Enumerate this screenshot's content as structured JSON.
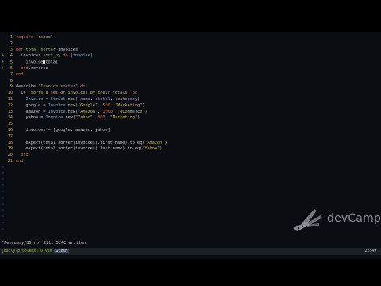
{
  "code_lines": [
    {
      "n": "1",
      "sign": "",
      "tokens": [
        {
          "c": "kw",
          "t": "require "
        },
        {
          "c": "str",
          "t": "\"rspec\""
        }
      ]
    },
    {
      "n": "2",
      "sign": "",
      "tokens": []
    },
    {
      "n": "3",
      "sign": "",
      "tokens": [
        {
          "c": "kw",
          "t": "def "
        },
        {
          "c": "mth",
          "t": "total_sorter"
        },
        {
          "c": "pl",
          "t": " invoices"
        }
      ]
    },
    {
      "n": "4",
      "sign": "+",
      "tokens": [
        {
          "c": "pl",
          "t": "  invoices."
        },
        {
          "c": "mth",
          "t": "sort_by"
        },
        {
          "c": "kw",
          "t": " do "
        },
        {
          "c": "pl",
          "t": "|"
        },
        {
          "c": "cst",
          "t": "invoice"
        },
        {
          "c": "pl",
          "t": "|"
        }
      ]
    },
    {
      "n": "5",
      "sign": "+",
      "tokens": [
        {
          "c": "pl",
          "t": "    invoice"
        },
        {
          "c": "cursor",
          "t": ""
        },
        {
          "c": "pl",
          "t": "total"
        }
      ]
    },
    {
      "n": "6",
      "sign": "+",
      "tokens": [
        {
          "c": "kw",
          "t": "  end"
        },
        {
          "c": "pl",
          "t": ".reverse"
        }
      ]
    },
    {
      "n": "7",
      "sign": "",
      "tokens": [
        {
          "c": "kw",
          "t": "end"
        }
      ]
    },
    {
      "n": "8",
      "sign": "",
      "tokens": []
    },
    {
      "n": "9",
      "sign": "",
      "tokens": [
        {
          "c": "pl",
          "t": "describe "
        },
        {
          "c": "str",
          "t": "\"Invoice sorter\""
        },
        {
          "c": "kw",
          "t": " do"
        }
      ]
    },
    {
      "n": "10",
      "sign": "",
      "tokens": [
        {
          "c": "pl",
          "t": "  it "
        },
        {
          "c": "str",
          "t": "\"sorts a set of invoices by their totals\""
        },
        {
          "c": "kw",
          "t": " do"
        }
      ]
    },
    {
      "n": "11",
      "sign": "",
      "tokens": [
        {
          "c": "cst",
          "t": "    Invoice"
        },
        {
          "c": "pl",
          "t": " = "
        },
        {
          "c": "cst",
          "t": "Struct"
        },
        {
          "c": "pl",
          "t": ".new("
        },
        {
          "c": "sym",
          "t": ":name"
        },
        {
          "c": "pl",
          "t": ", "
        },
        {
          "c": "sym",
          "t": ":total"
        },
        {
          "c": "pl",
          "t": ", "
        },
        {
          "c": "sym",
          "t": ":category"
        },
        {
          "c": "pl",
          "t": ")"
        }
      ]
    },
    {
      "n": "12",
      "sign": "",
      "tokens": [
        {
          "c": "pl",
          "t": "    google = "
        },
        {
          "c": "cst",
          "t": "Invoice"
        },
        {
          "c": "pl",
          "t": ".new("
        },
        {
          "c": "str",
          "t": "\"Google\""
        },
        {
          "c": "pl",
          "t": ", "
        },
        {
          "c": "num",
          "t": "500"
        },
        {
          "c": "pl",
          "t": ", "
        },
        {
          "c": "str",
          "t": "\"Marketing\""
        },
        {
          "c": "pl",
          "t": ")"
        }
      ]
    },
    {
      "n": "13",
      "sign": "",
      "tokens": [
        {
          "c": "pl",
          "t": "    amazon = "
        },
        {
          "c": "cst",
          "t": "Invoice"
        },
        {
          "c": "pl",
          "t": ".new("
        },
        {
          "c": "str",
          "t": "\"Amazon\""
        },
        {
          "c": "pl",
          "t": ", "
        },
        {
          "c": "num",
          "t": "1000"
        },
        {
          "c": "pl",
          "t": ", "
        },
        {
          "c": "str",
          "t": "\"eCommerce\""
        },
        {
          "c": "pl",
          "t": ")"
        }
      ]
    },
    {
      "n": "14",
      "sign": "",
      "tokens": [
        {
          "c": "pl",
          "t": "    yahoo = "
        },
        {
          "c": "cst",
          "t": "Invoice"
        },
        {
          "c": "pl",
          "t": ".new("
        },
        {
          "c": "str",
          "t": "\"Yahoo\""
        },
        {
          "c": "pl",
          "t": ", "
        },
        {
          "c": "num",
          "t": "300"
        },
        {
          "c": "pl",
          "t": ", "
        },
        {
          "c": "str",
          "t": "\"Marketing\""
        },
        {
          "c": "pl",
          "t": ")"
        }
      ]
    },
    {
      "n": "15",
      "sign": "",
      "tokens": []
    },
    {
      "n": "16",
      "sign": "",
      "tokens": [
        {
          "c": "pl",
          "t": "    invoices = [google, amazon, yahoo]"
        }
      ]
    },
    {
      "n": "17",
      "sign": "",
      "tokens": []
    },
    {
      "n": "18",
      "sign": "",
      "tokens": [
        {
          "c": "pl",
          "t": "    expect(total_sorter(invoices).first.name).to eq("
        },
        {
          "c": "str",
          "t": "\"Amazon\""
        },
        {
          "c": "pl",
          "t": ")"
        }
      ]
    },
    {
      "n": "19",
      "sign": "",
      "tokens": [
        {
          "c": "pl",
          "t": "    expect(total_sorter(invoices).last.name).to eq("
        },
        {
          "c": "str",
          "t": "\"Yahoo\""
        },
        {
          "c": "pl",
          "t": ")"
        }
      ]
    },
    {
      "n": "20",
      "sign": "",
      "tokens": [
        {
          "c": "kw",
          "t": "  end"
        }
      ]
    },
    {
      "n": "21",
      "sign": "",
      "tokens": [
        {
          "c": "kw",
          "t": "end"
        }
      ]
    }
  ],
  "tilde_char": "~",
  "tilde_count": 11,
  "message_line": "\"February/30.rb\" 22L, 524C written",
  "statusbar": {
    "left": "[daily-problems] ",
    "session": "0:vim",
    "window": "1:zsh",
    "right": "22:49"
  },
  "watermark": {
    "text": "devCamp",
    "icon": "devcamp-knife-logo"
  },
  "colors": {
    "background": "#0a0d12",
    "line_number": "#c9a13c",
    "tilde": "#3b6ea8"
  }
}
